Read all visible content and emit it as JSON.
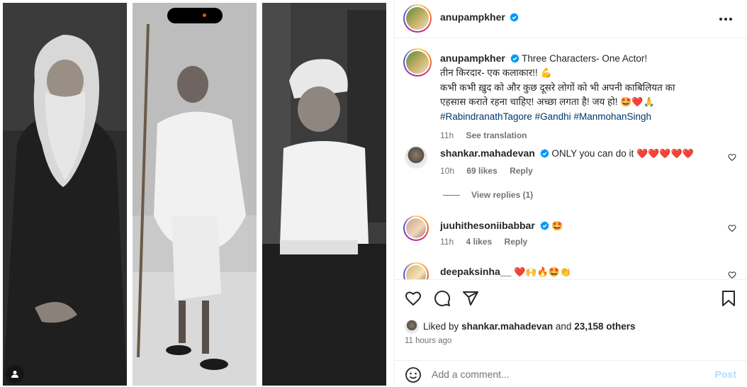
{
  "post": {
    "author": "anupampkher",
    "caption": {
      "line1": "Three Characters- One Actor!",
      "line2": "तीन किरदार- एक कलाकार!!",
      "line3": "कभी कभी ख़ुद को और कुछ दूसरे लोगों को भी अपनी काबिलियत का",
      "line4": "एहसास कराते रहना चाहिए! अच्छा लगता है! जय हो!",
      "hashtags": [
        "#RabindranathTagore",
        "#Gandhi",
        "#ManmohanSingh"
      ],
      "time": "11h",
      "see_translation": "See translation",
      "emoji_line2": "💪",
      "emoji_line4": "🤩❤️🙏"
    }
  },
  "comments": [
    {
      "user": "shankar.mahadevan",
      "text": "ONLY you can do it",
      "emoji": "❤️❤️❤️❤️❤️",
      "time": "10h",
      "likes": "69 likes",
      "reply": "Reply",
      "view_replies": "View replies (1)"
    },
    {
      "user": "juuhithesoniibabbar",
      "text": "",
      "emoji": "🤩",
      "time": "11h",
      "likes": "4 likes",
      "reply": "Reply"
    },
    {
      "user": "deepaksinha__",
      "text": "",
      "emoji": "❤️🙌🔥🤩👏"
    }
  ],
  "likes": {
    "prefix": "Liked by",
    "user": "shankar.mahadevan",
    "and": "and",
    "others": "23,158 others"
  },
  "timestamp": "11 hours ago",
  "add_comment": {
    "placeholder": "Add a comment...",
    "post_label": "Post"
  },
  "colors": {
    "verified": "#0095f6",
    "hashtag": "#00376b",
    "like_red": "#ed4956",
    "post_disabled": "#b3dbff",
    "muted": "#737373"
  },
  "icons": [
    "heart-icon",
    "comment-icon",
    "share-icon",
    "bookmark-icon",
    "more-icon",
    "emoji-icon",
    "verified-icon",
    "user-tag-icon"
  ]
}
